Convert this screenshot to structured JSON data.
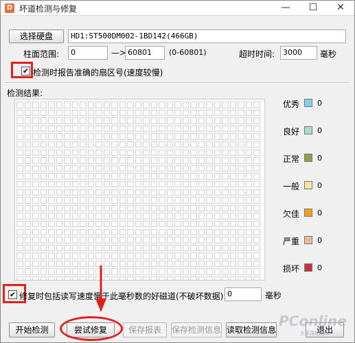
{
  "window": {
    "title": "坏道检测与修复",
    "app_icon_glyph": "D",
    "controls": {
      "minimize": "—",
      "maximize": "☐",
      "close": "✕"
    }
  },
  "disk": {
    "select_button": "选择硬盘",
    "info": "HD1:ST500DM002-1BD142(466GB)"
  },
  "cylinder": {
    "label": "柱面范围:",
    "start": "0",
    "arrow": "—>",
    "end": "60801",
    "range_hint": "(0-60801)"
  },
  "timeout": {
    "label": "超时时间:",
    "value": "3000",
    "unit": "毫秒"
  },
  "report_accurate": {
    "checked": "✔",
    "label": "检测时报告准确的扇区号(速度较慢)"
  },
  "results": {
    "label": "检测结果:",
    "rows": 25,
    "cols": 31
  },
  "legend": [
    {
      "name": "优秀",
      "color": "#7fd0e8",
      "count": "0"
    },
    {
      "name": "良好",
      "color": "#a8dcc8",
      "count": "0"
    },
    {
      "name": "正常",
      "color": "#8aa34a",
      "count": "0"
    },
    {
      "name": "一般",
      "color": "#f3e89a",
      "count": "0"
    },
    {
      "name": "欠佳",
      "color": "#f0a21e",
      "count": "0"
    },
    {
      "name": "严重",
      "color": "#e5b8a0",
      "count": "0"
    },
    {
      "name": "损坏",
      "color": "#c8323a",
      "count": "0"
    }
  ],
  "repair_slow": {
    "checked": "✔",
    "label": "修复时包括读写速度慢于此毫秒数的好磁道(不破坏数据):",
    "value": "0",
    "unit": "毫秒"
  },
  "buttons": {
    "start": "开始检测",
    "try_repair": "尝试修复",
    "save_report": "保存报表",
    "save_info": "保存检测信息",
    "read_info": "读取检测信息",
    "exit": "退出"
  },
  "watermark": {
    "text": "PConline",
    "sub": "太平洋电脑网"
  }
}
